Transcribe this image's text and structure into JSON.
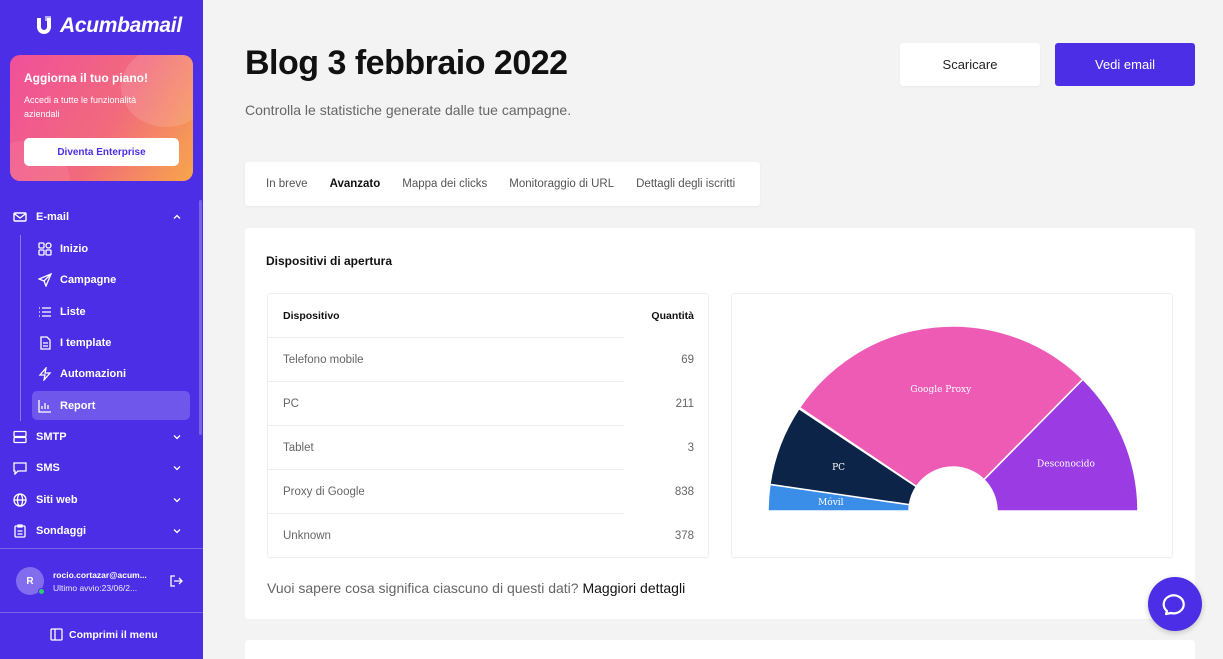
{
  "brand": {
    "name": "Acumbamail"
  },
  "upgrade": {
    "title": "Aggiorna il tuo piano!",
    "description": "Accedi a tutte le funzionalità aziendali",
    "button": "Diventa Enterprise"
  },
  "sidebar": {
    "email_section": "E-mail",
    "items": [
      {
        "label": "Inizio",
        "icon": "grid-icon"
      },
      {
        "label": "Campagne",
        "icon": "send-icon"
      },
      {
        "label": "Liste",
        "icon": "list-icon"
      },
      {
        "label": "I template",
        "icon": "document-icon"
      },
      {
        "label": "Automazioni",
        "icon": "bolt-icon"
      },
      {
        "label": "Report",
        "icon": "bar-chart-icon",
        "active": true
      }
    ],
    "sections": [
      {
        "label": "SMTP",
        "icon": "server-icon"
      },
      {
        "label": "SMS",
        "icon": "chat-icon"
      },
      {
        "label": "Siti web",
        "icon": "globe-icon"
      },
      {
        "label": "Sondaggi",
        "icon": "clipboard-icon"
      }
    ],
    "collapse_label": "Comprimi il menu"
  },
  "user": {
    "initial": "R",
    "email": "rocio.cortazar@acum...",
    "last_login": "Ultimo avvio:23/06/2..."
  },
  "header": {
    "title": "Blog 3 febbraio 2022",
    "subtitle": "Controlla le statistiche generate dalle tue campagne.",
    "download_label": "Scaricare",
    "view_email_label": "Vedi email"
  },
  "tabs": [
    {
      "label": "In breve",
      "active": false
    },
    {
      "label": "Avanzato",
      "active": true
    },
    {
      "label": "Mappa dei clicks",
      "active": false
    },
    {
      "label": "Monitoraggio di URL",
      "active": false
    },
    {
      "label": "Dettagli degli iscritti",
      "active": false
    }
  ],
  "devices": {
    "title": "Dispositivi di apertura",
    "col_device": "Dispositivo",
    "col_qty": "Quantità",
    "rows": [
      {
        "device": "Telefono mobile",
        "qty": "69"
      },
      {
        "device": "PC",
        "qty": "211"
      },
      {
        "device": "Tablet",
        "qty": "3"
      },
      {
        "device": "Proxy di Google",
        "qty": "838"
      },
      {
        "device": "Unknown",
        "qty": "378"
      }
    ]
  },
  "chart_data": {
    "type": "pie",
    "style": "half-donut",
    "categories": [
      "Móvil",
      "PC",
      "Tablet",
      "Google Proxy",
      "Desconocido"
    ],
    "values": [
      69,
      211,
      3,
      838,
      378
    ],
    "colors": [
      "#3b8ee8",
      "#0d2449",
      "#0d2449",
      "#ee5bb5",
      "#9a3be3"
    ]
  },
  "footer_note": {
    "text": "Vuoi sapere cosa significa ciascuno di questi dati? ",
    "link": "Maggiori dettagli"
  }
}
